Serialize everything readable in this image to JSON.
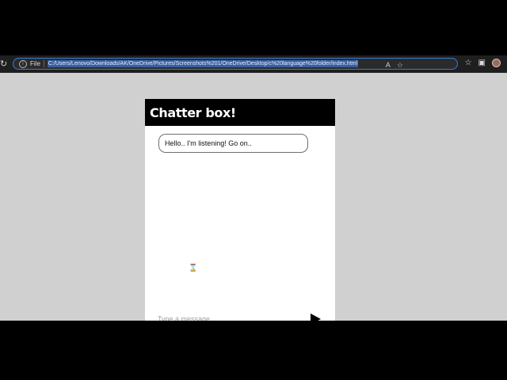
{
  "browser": {
    "file_label": "File",
    "url": "C:/Users/Lenovo/Downloads/AK/OneDrive/Pictures/Screenshots%201/OneDrive/Desktop/c%20language%20folder/index.html",
    "left_icon_names": [
      "reload-icon",
      "info-icon"
    ],
    "right_icon_names": [
      "read-aloud-icon",
      "favorite-icon",
      "favorites-icon",
      "collections-icon",
      "profile-avatar"
    ]
  },
  "chat": {
    "title": "Chatter box!",
    "messages": [
      {
        "text": "Hello.. I'm listening! Go on.."
      }
    ],
    "input_placeholder": "Type a message",
    "send_icon": "send-icon"
  },
  "colors": {
    "background": "#d0d0d0",
    "header": "#000000",
    "chat_background": "#ffffff",
    "url_highlight": "#3a5f9f"
  }
}
